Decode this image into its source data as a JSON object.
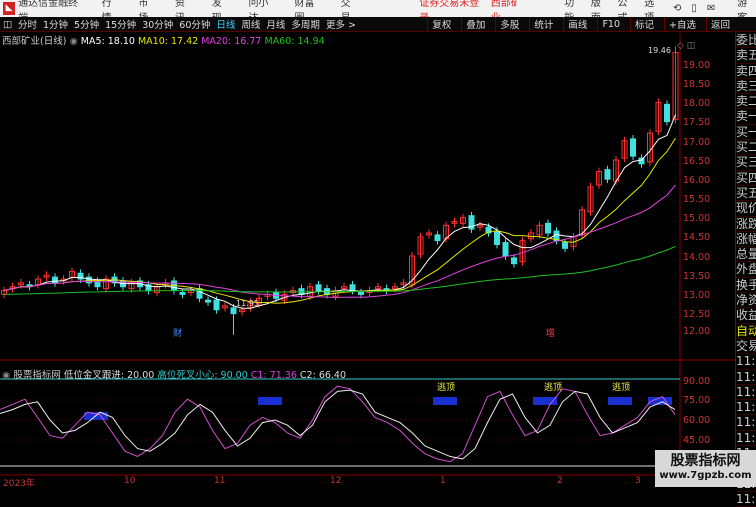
{
  "titlebar": {
    "app": "通达信金融终端",
    "menus": [
      "行情",
      "市场",
      "资讯",
      "发现",
      "问小达",
      "财富圈",
      "交易"
    ],
    "status": "证券交易未登录",
    "stock": "西部矿业",
    "right": [
      "功能",
      "版面",
      "公式",
      "选项"
    ],
    "user": "游客"
  },
  "toolbar": {
    "periods": [
      "分时",
      "1分钟",
      "5分钟",
      "15分钟",
      "30分钟",
      "60分钟",
      "日线",
      "周线",
      "月线",
      "多周期",
      "更多 >"
    ],
    "active": "日线",
    "right": [
      "复权",
      "叠加",
      "多股",
      "统计",
      "画线",
      "F10",
      "标记",
      "+自选",
      "返回"
    ]
  },
  "ma": {
    "name": "西部矿业(日线)",
    "ma5": "MA5: 18.10",
    "ma10": "MA10: 17.42",
    "ma20": "MA20: 16.77",
    "ma60": "MA60: 14.94"
  },
  "colors": {
    "ma5": "#ffffff",
    "ma10": "#e6e600",
    "ma20": "#e040e0",
    "ma60": "#20c020",
    "up": "#ff3030",
    "down": "#40e0e0"
  },
  "price_axis": [
    "19.00",
    "18.50",
    "18.00",
    "17.50",
    "17.00",
    "16.50",
    "16.00",
    "15.50",
    "15.00",
    "14.50",
    "14.00",
    "13.50",
    "13.00",
    "12.50",
    "12.00"
  ],
  "annotations": {
    "high": "19.46",
    "low": "11.95",
    "cai": "财",
    "zeng": "增"
  },
  "indicator": {
    "name": "股票指标网",
    "p1": "低位金叉跟进: 20.00",
    "p2": "高位死叉小心: 90.00",
    "c1": "C1: 71.36",
    "c2": "C2: 66.40",
    "axis": [
      "90.00",
      "75.00",
      "60.00",
      "45.00"
    ],
    "top_label": "逃顶"
  },
  "dates": [
    "2023年",
    "10",
    "11",
    "12",
    "1",
    "2",
    "3"
  ],
  "right_panel": [
    "委比",
    "卖五",
    "卖四",
    "卖三",
    "卖二",
    "卖一",
    "买一",
    "买二",
    "买三",
    "买四",
    "买五",
    "现价",
    "涨跌",
    "涨幅",
    "总量",
    "外盘",
    "换手",
    "净资",
    "收益",
    "自动",
    "交易",
    "11:29",
    "11:29",
    "11:29",
    "11:29",
    "11:29",
    "11:29",
    "11:29",
    "11:29",
    "11:29",
    "11:29"
  ],
  "watermark": {
    "line1": "股票指标网",
    "line2": "www.7gpzb.com"
  },
  "chart_data": {
    "type": "candlestick",
    "closes": [
      13.1,
      13.2,
      13.3,
      13.2,
      13.4,
      13.5,
      13.3,
      13.4,
      13.6,
      13.4,
      13.3,
      13.2,
      13.4,
      13.3,
      13.2,
      13.3,
      13.2,
      13.1,
      13.2,
      13.3,
      13.1,
      13.0,
      13.1,
      12.9,
      12.8,
      12.6,
      12.7,
      12.5,
      12.6,
      12.8,
      12.9,
      13.0,
      12.9,
      13.0,
      13.1,
      13.0,
      13.2,
      13.1,
      13.0,
      13.1,
      13.2,
      13.1,
      13.0,
      13.1,
      13.2,
      13.1,
      13.2,
      13.3,
      14.0,
      14.5,
      14.6,
      14.4,
      14.8,
      14.9,
      15.0,
      14.7,
      14.8,
      14.6,
      14.3,
      14.0,
      13.8,
      14.4,
      14.6,
      14.8,
      14.6,
      14.4,
      14.2,
      14.5,
      15.2,
      15.8,
      16.2,
      16.0,
      16.5,
      17.0,
      16.6,
      16.4,
      17.2,
      18.0,
      17.5,
      19.3
    ],
    "ind_white": [
      65,
      68,
      72,
      74,
      60,
      50,
      52,
      58,
      66,
      62,
      48,
      38,
      36,
      42,
      50,
      64,
      72,
      66,
      52,
      40,
      46,
      58,
      60,
      56,
      48,
      56,
      74,
      82,
      83,
      80,
      66,
      62,
      58,
      50,
      40,
      36,
      32,
      30,
      38,
      58,
      76,
      80,
      62,
      50,
      56,
      74,
      82,
      80,
      62,
      50,
      54,
      58,
      70,
      74,
      68
    ],
    "ind_magenta": [
      68,
      72,
      76,
      62,
      48,
      46,
      56,
      66,
      64,
      50,
      36,
      32,
      38,
      48,
      66,
      76,
      70,
      52,
      38,
      42,
      56,
      62,
      58,
      50,
      46,
      60,
      78,
      86,
      84,
      74,
      62,
      58,
      52,
      42,
      34,
      30,
      28,
      34,
      56,
      78,
      82,
      64,
      48,
      52,
      72,
      84,
      82,
      64,
      48,
      50,
      56,
      62,
      74,
      78,
      64
    ]
  }
}
